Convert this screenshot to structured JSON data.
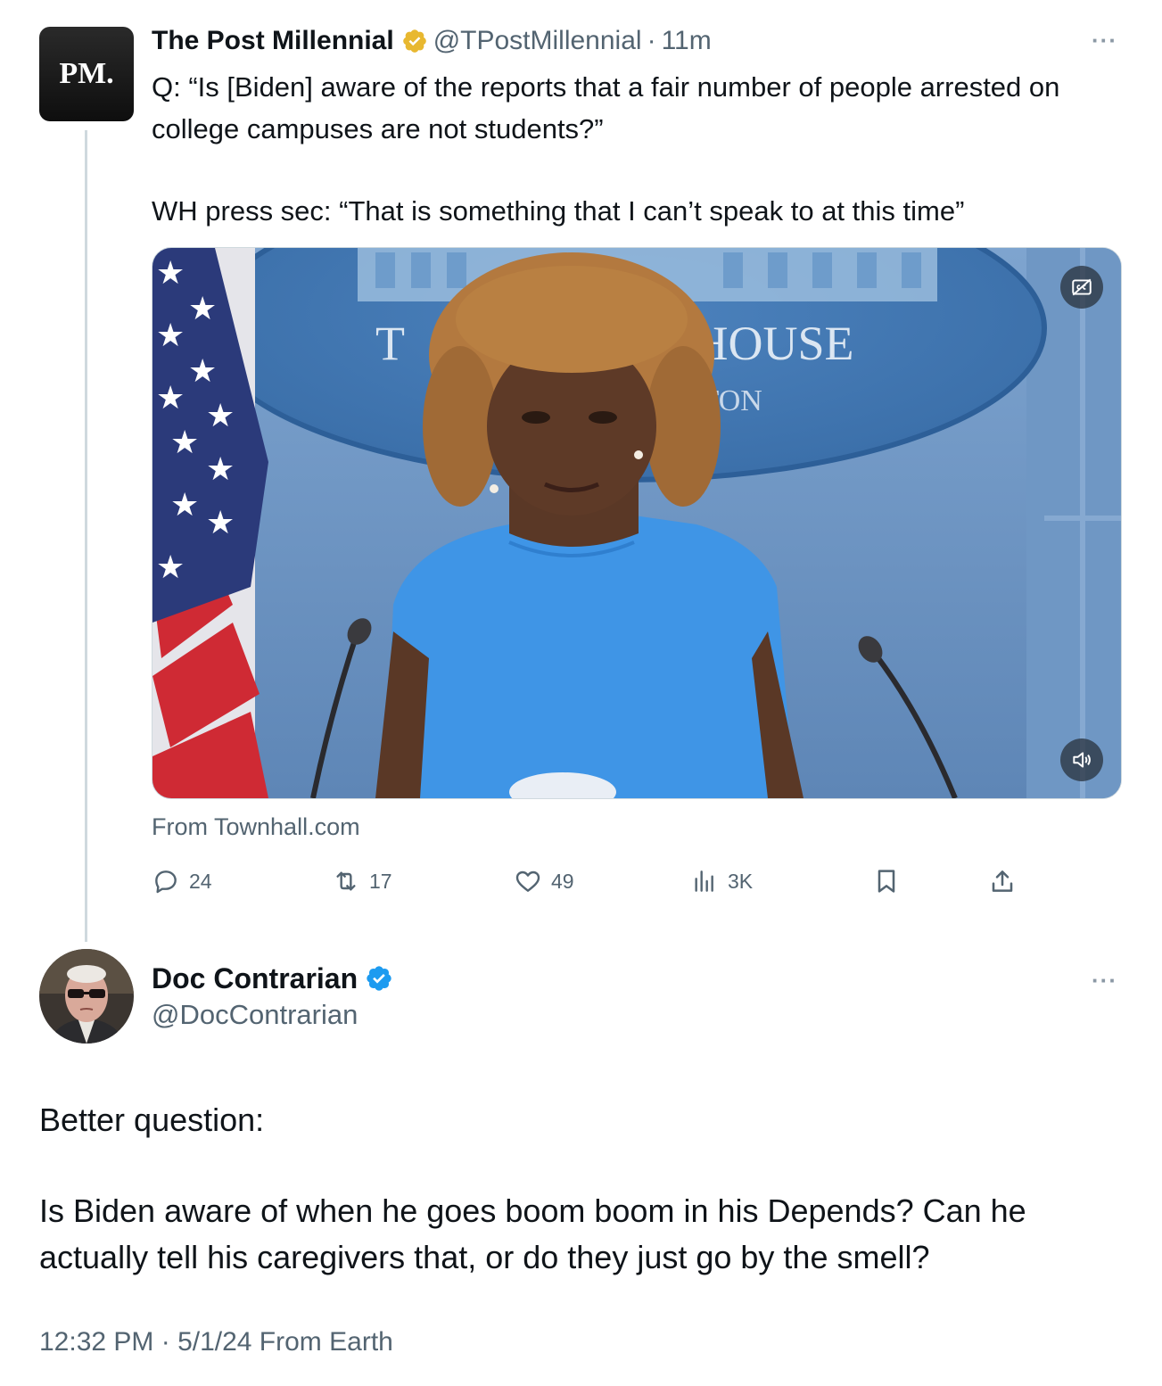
{
  "quoted_tweet": {
    "avatar_text": "PM.",
    "name": "The Post Millennial",
    "handle": "@TPostMillennial",
    "separator": "·",
    "time": "11m",
    "more_label": "···",
    "text_line1": "Q: “Is [Biden] aware of the reports that a fair number of people arrested on college campuses are not students?”",
    "text_line2": "WH press sec: “That is something that I can’t speak to at this time”",
    "video_sign_line1": "THE WHITE HOUSE",
    "video_sign_line2": "WASHINGTON",
    "source": "From Townhall.com",
    "stats": {
      "replies": "24",
      "reposts": "17",
      "likes": "49",
      "views": "3K"
    },
    "icons": [
      "reply-icon",
      "repost-icon",
      "like-icon",
      "views-icon",
      "bookmark-icon",
      "share-icon",
      "captions-icon",
      "volume-icon",
      "verified-gold-badge-icon"
    ],
    "colors": {
      "gold_badge": "#e8b830",
      "muted": "#536471"
    }
  },
  "main_tweet": {
    "name": "Doc Contrarian",
    "handle": "@DocContrarian",
    "more_label": "···",
    "text_line1": "Better question:",
    "text_line2": "Is Biden aware of when he goes boom boom in his Depends? Can he actually tell his caregivers that, or do they just go by the smell?",
    "footer": "12:32 PM · 5/1/24 From Earth",
    "colors": {
      "blue_badge": "#1d9bf0"
    }
  }
}
